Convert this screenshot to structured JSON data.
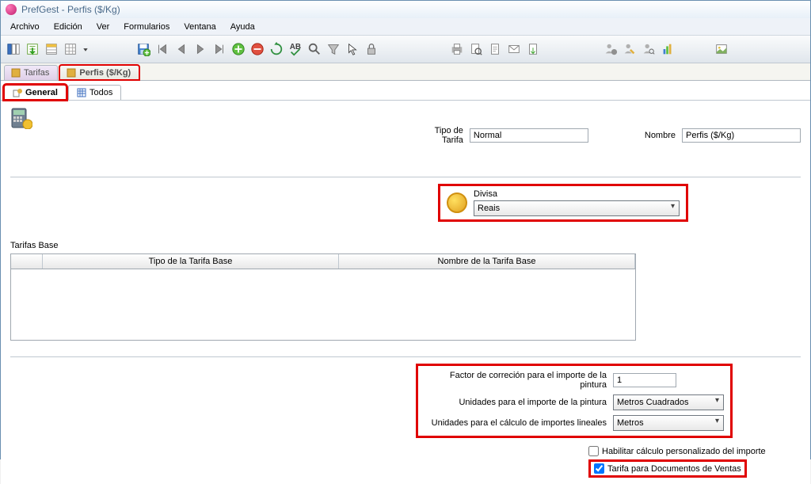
{
  "window": {
    "title": "PrefGest - Perfis ($/Kg)"
  },
  "menu": {
    "archivo": "Archivo",
    "edicion": "Edición",
    "ver": "Ver",
    "formularios": "Formularios",
    "ventana": "Ventana",
    "ayuda": "Ayuda"
  },
  "tabs": {
    "tarifas": "Tarifas",
    "perfis": "Perfis ($/Kg)"
  },
  "subtabs": {
    "general": "General",
    "todos": "Todos"
  },
  "fields": {
    "tipo_tarifa_label": "Tipo de Tarifa",
    "tipo_tarifa_value": "Normal",
    "nombre_label": "Nombre",
    "nombre_value": "Perfis ($/Kg)",
    "divisa_label": "Divisa",
    "divisa_value": "Reais",
    "tarifas_base_label": "Tarifas Base",
    "th_tipo": "Tipo de la Tarifa Base",
    "th_nombre": "Nombre de la Tarifa Base",
    "factor_label": "Factor de correción para el importe de la pintura",
    "factor_value": "1",
    "unid_pintura_label": "Unidades para el importe de la pintura",
    "unid_pintura_value": "Metros Cuadrados",
    "unid_lineal_label": "Unidades para el cálculo de importes lineales",
    "unid_lineal_value": "Metros",
    "habilitar_label": "Habilitar cálculo personalizado del importe",
    "tarifa_doc_label": "Tarifa para Documentos de Ventas"
  }
}
